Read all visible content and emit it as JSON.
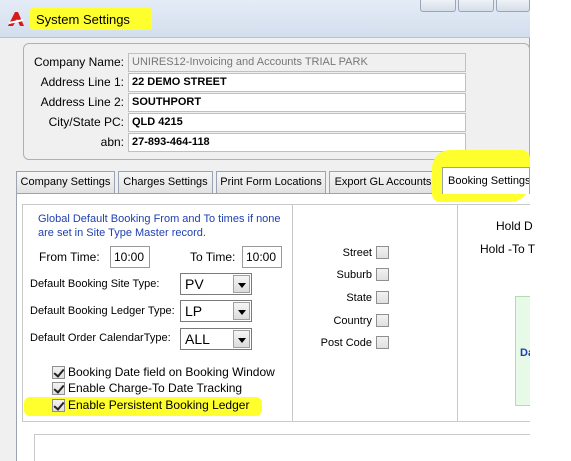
{
  "window": {
    "title": "System Settings"
  },
  "company": {
    "fields": [
      {
        "label": "Company Name:",
        "value": "UNIRES12-Invoicing and Accounts TRIAL PARK"
      },
      {
        "label": "Address Line 1:",
        "value": "22 DEMO STREET"
      },
      {
        "label": "Address Line 2:",
        "value": "SOUTHPORT"
      },
      {
        "label": "City/State PC:",
        "value": "QLD 4215"
      },
      {
        "label": "abn:",
        "value": "27-893-464-118"
      }
    ]
  },
  "tabs": [
    {
      "label": "Company Settings"
    },
    {
      "label": "Charges Settings"
    },
    {
      "label": "Print Form Locations"
    },
    {
      "label": "Export GL Accounts"
    },
    {
      "label": "Booking Settings",
      "active": true
    }
  ],
  "booking": {
    "info": "Global Default Booking From and To times if none are set in Site Type Master record.",
    "from_label": "From Time:",
    "from_value": "10:00",
    "to_label": "To Time:",
    "to_value": "10:00",
    "site_type_label": "Default Booking Site Type:",
    "site_type_value": "PV",
    "ledger_type_label": "Default Booking Ledger Type:",
    "ledger_type_value": "LP",
    "order_label": "Default Order CalendarType:",
    "order_value": "ALL",
    "checkboxes": [
      {
        "label": "Booking Date field on Booking Window",
        "checked": true
      },
      {
        "label": "Enable Charge-To Date Tracking",
        "checked": true
      },
      {
        "label": "Enable Persistent Booking Ledger",
        "checked": true
      }
    ]
  },
  "address_fields": [
    {
      "label": "Street",
      "checked": false
    },
    {
      "label": "Suburb",
      "checked": false
    },
    {
      "label": "State",
      "checked": false
    },
    {
      "label": "Country",
      "checked": false
    },
    {
      "label": "Post Code",
      "checked": false
    }
  ],
  "hold": {
    "from_label": "Hold D",
    "to_label": "Hold -To T",
    "panel_text": "Da"
  },
  "colors": {
    "highlight": "#ffff2e",
    "info_text": "#1f3fb0"
  }
}
